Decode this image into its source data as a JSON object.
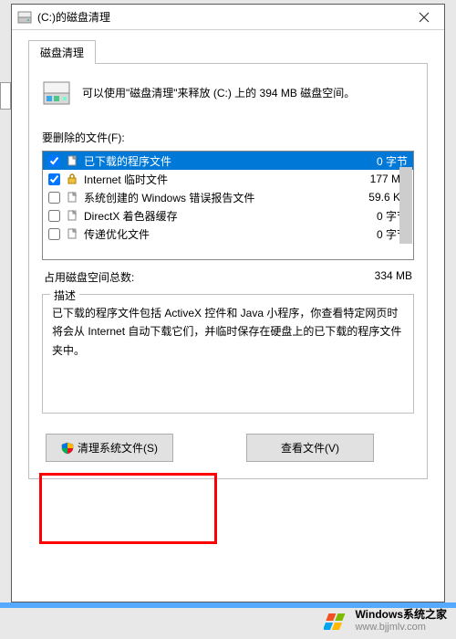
{
  "titlebar": {
    "title": "(C:)的磁盘清理"
  },
  "tab": {
    "label": "磁盘清理"
  },
  "info": {
    "text": "可以使用\"磁盘清理\"来释放  (C:) 上的 394 MB 磁盘空间。"
  },
  "files_label": "要删除的文件(F):",
  "files": [
    {
      "checked": true,
      "selected": true,
      "icon": "file-icon",
      "name": "已下载的程序文件",
      "size": "0 字节"
    },
    {
      "checked": true,
      "selected": false,
      "icon": "lock-icon",
      "name": "Internet 临时文件",
      "size": "177 MB"
    },
    {
      "checked": false,
      "selected": false,
      "icon": "file-icon",
      "name": "系统创建的 Windows 错误报告文件",
      "size": "59.6 KB"
    },
    {
      "checked": false,
      "selected": false,
      "icon": "file-icon",
      "name": "DirectX 着色器缓存",
      "size": "0 字节"
    },
    {
      "checked": false,
      "selected": false,
      "icon": "file-icon",
      "name": "传递优化文件",
      "size": "0 字节"
    }
  ],
  "total": {
    "label": "占用磁盘空间总数:",
    "value": "334 MB"
  },
  "desc": {
    "legend": "描述",
    "text": "已下载的程序文件包括 ActiveX 控件和 Java 小程序，你查看特定网页时将会从 Internet 自动下载它们，并临时保存在硬盘上的已下载的程序文件夹中。"
  },
  "buttons": {
    "clean_system": "清理系统文件(S)",
    "view_files": "查看文件(V)"
  },
  "watermark": {
    "name": "Windows系统之家",
    "url": "www.bjjmlv.com"
  }
}
